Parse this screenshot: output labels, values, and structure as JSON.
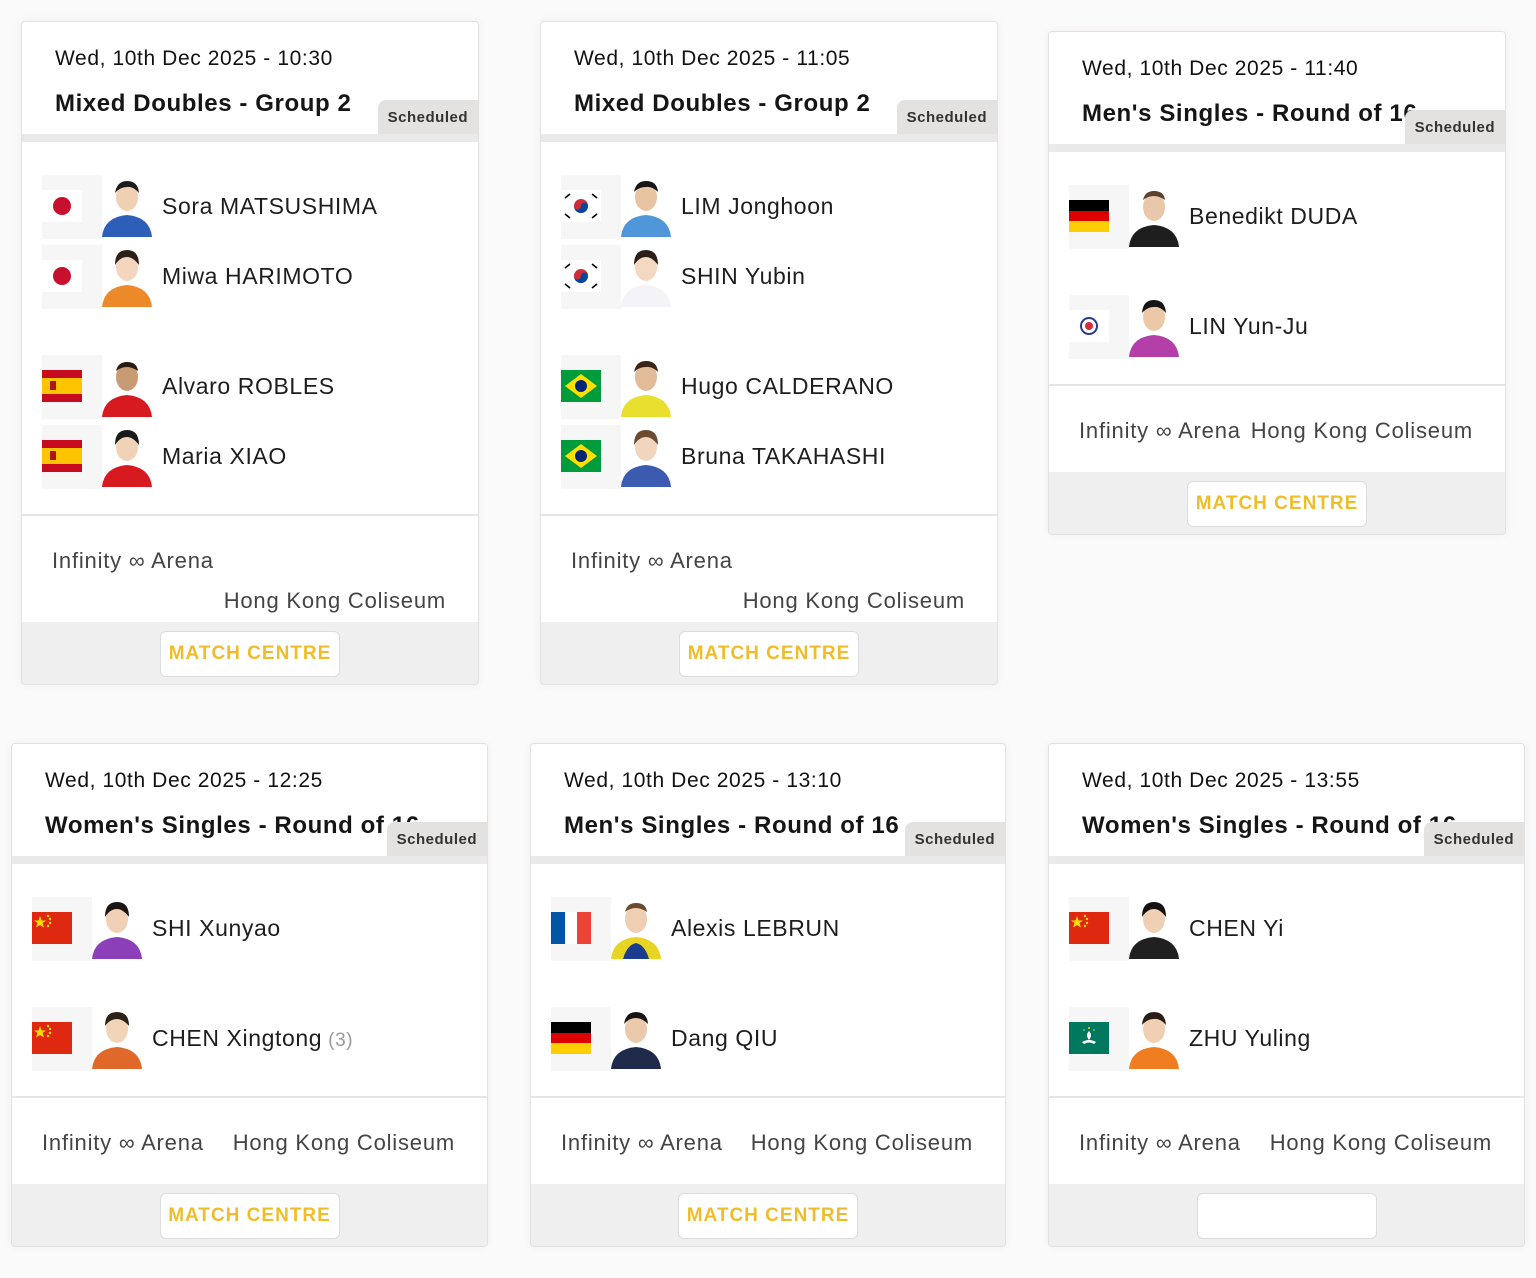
{
  "status_label": "Scheduled",
  "match_centre_label": "MATCH CENTRE",
  "matches": [
    {
      "date": "Wed, 10th Dec 2025 - 10:30",
      "title": "Mixed Doubles - Group 2",
      "venue_main": "Infinity ∞ Arena",
      "venue_sub": "Hong Kong Coliseum",
      "players": [
        {
          "name": "Sora MATSUSHIMA",
          "country_flag": "japan-flag",
          "seed": ""
        },
        {
          "name": "Miwa HARIMOTO",
          "country_flag": "japan-flag",
          "seed": ""
        },
        {
          "name": "Alvaro ROBLES",
          "country_flag": "spain-flag",
          "seed": ""
        },
        {
          "name": "Maria XIAO",
          "country_flag": "spain-flag",
          "seed": ""
        }
      ]
    },
    {
      "date": "Wed, 10th Dec 2025 - 11:05",
      "title": "Mixed Doubles - Group 2",
      "venue_main": "Infinity ∞ Arena",
      "venue_sub": "Hong Kong Coliseum",
      "players": [
        {
          "name": "LIM Jonghoon",
          "country_flag": "korea-flag",
          "seed": ""
        },
        {
          "name": "SHIN Yubin",
          "country_flag": "korea-flag",
          "seed": ""
        },
        {
          "name": "Hugo CALDERANO",
          "country_flag": "brazil-flag",
          "seed": ""
        },
        {
          "name": "Bruna TAKAHASHI",
          "country_flag": "brazil-flag",
          "seed": ""
        }
      ]
    },
    {
      "date": "Wed, 10th Dec 2025 - 11:40",
      "title": "Men's Singles - Round of 16",
      "venue_main": "Infinity ∞ Arena",
      "venue_sub": "Hong Kong Coliseum",
      "players": [
        {
          "name": "Benedikt DUDA",
          "country_flag": "germany-flag",
          "seed": ""
        },
        {
          "name": "LIN Yun-Ju",
          "country_flag": "chinese-taipei-flag",
          "seed": ""
        }
      ]
    },
    {
      "date": "Wed, 10th Dec 2025 - 12:25",
      "title": "Women's Singles - Round of 16",
      "venue_main": "Infinity ∞ Arena",
      "venue_sub": "Hong Kong Coliseum",
      "players": [
        {
          "name": "SHI Xunyao",
          "country_flag": "china-flag",
          "seed": ""
        },
        {
          "name": "CHEN Xingtong",
          "country_flag": "china-flag",
          "seed": "(3)"
        }
      ]
    },
    {
      "date": "Wed, 10th Dec 2025 - 13:10",
      "title": "Men's Singles - Round of 16",
      "venue_main": "Infinity ∞ Arena",
      "venue_sub": "Hong Kong Coliseum",
      "players": [
        {
          "name": "Alexis LEBRUN",
          "country_flag": "france-flag",
          "seed": ""
        },
        {
          "name": "Dang QIU",
          "country_flag": "germany-flag",
          "seed": ""
        }
      ]
    },
    {
      "date": "Wed, 10th Dec 2025 - 13:55",
      "title": "Women's Singles - Round of 16",
      "venue_main": "Infinity ∞ Arena",
      "venue_sub": "Hong Kong Coliseum",
      "players": [
        {
          "name": "CHEN Yi",
          "country_flag": "china-flag",
          "seed": ""
        },
        {
          "name": "ZHU Yuling",
          "country_flag": "macao-flag",
          "seed": ""
        }
      ]
    }
  ]
}
